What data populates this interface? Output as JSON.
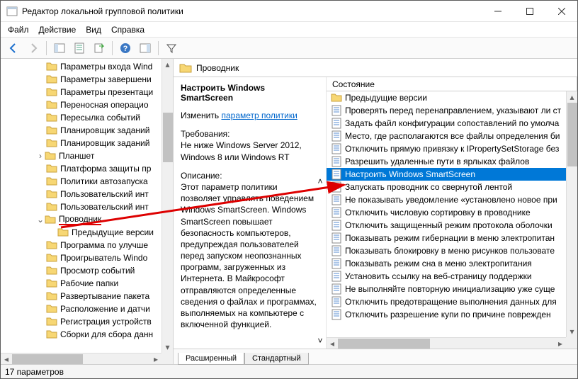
{
  "window": {
    "title": "Редактор локальной групповой политики"
  },
  "menu": {
    "file": "Файл",
    "action": "Действие",
    "view": "Вид",
    "help": "Справка"
  },
  "tree": {
    "items": [
      {
        "label": "Параметры входа Wind",
        "indent": 1
      },
      {
        "label": "Параметры завершени",
        "indent": 1
      },
      {
        "label": "Параметры презентаци",
        "indent": 1
      },
      {
        "label": "Переносная операцио",
        "indent": 1
      },
      {
        "label": "Пересылка событий",
        "indent": 1
      },
      {
        "label": "Планировщик заданий",
        "indent": 1
      },
      {
        "label": "Планировщик заданий",
        "indent": 1
      },
      {
        "label": "Планшет",
        "indent": 1,
        "expander": ">"
      },
      {
        "label": "Платформа защиты пр",
        "indent": 1
      },
      {
        "label": "Политики автозапуска",
        "indent": 1
      },
      {
        "label": "Пользовательский инт",
        "indent": 1
      },
      {
        "label": "Пользовательский инт",
        "indent": 1
      },
      {
        "label": "Проводник",
        "indent": 1,
        "expander": "v",
        "selected": true
      },
      {
        "label": "Предыдущие версии",
        "indent": 2
      },
      {
        "label": "Программа по улучше",
        "indent": 1
      },
      {
        "label": "Проигрыватель Windo",
        "indent": 1
      },
      {
        "label": "Просмотр событий",
        "indent": 1
      },
      {
        "label": "Рабочие папки",
        "indent": 1
      },
      {
        "label": "Развертывание пакета",
        "indent": 1
      },
      {
        "label": "Расположение и датчи",
        "indent": 1
      },
      {
        "label": "Регистрация устройств",
        "indent": 1
      },
      {
        "label": "Сборки для сбора данн",
        "indent": 1
      }
    ]
  },
  "header": {
    "folder_label": "Проводник"
  },
  "detail": {
    "heading": "Настроить Windows SmartScreen",
    "change_label": "Изменить ",
    "change_link": "параметр политики",
    "req_label": "Требования:",
    "req_text": "Не ниже Windows Server 2012, Windows 8 или Windows RT",
    "desc_label": "Описание:",
    "desc_text": "Этот параметр политики позволяет управлять поведением Windows SmartScreen. Windows SmartScreen повышает безопасность компьютеров, предупреждая пользователей перед запуском неопознанных программ, загруженных из Интернета. В Майкрософт отправляются определенные сведения о файлах и программах, выполняемых на компьютере с включенной функцией."
  },
  "list": {
    "column": "Состояние",
    "items": [
      {
        "icon": "folder",
        "label": "Предыдущие версии"
      },
      {
        "icon": "setting",
        "label": "Проверять перед перенаправлением, указывают ли ст"
      },
      {
        "icon": "setting",
        "label": "Задать файл конфигурации сопоставлений по умолча"
      },
      {
        "icon": "setting",
        "label": "Место, где располагаются все файлы определения би"
      },
      {
        "icon": "setting",
        "label": "Отключить прямую привязку к IPropertySetStorage без"
      },
      {
        "icon": "setting",
        "label": "Разрешить удаленные пути в ярлыках файлов"
      },
      {
        "icon": "setting",
        "label": "Настроить Windows SmartScreen",
        "selected": true
      },
      {
        "icon": "setting",
        "label": "Запускать проводник со свернутой лентой"
      },
      {
        "icon": "setting",
        "label": "Не показывать уведомление «установлено новое при"
      },
      {
        "icon": "setting",
        "label": "Отключить числовую сортировку в проводнике"
      },
      {
        "icon": "setting",
        "label": "Отключить защищенный режим протокола оболочки"
      },
      {
        "icon": "setting",
        "label": "Показывать режим гибернации в меню электропитан"
      },
      {
        "icon": "setting",
        "label": "Показывать блокировку в меню рисунков пользовате"
      },
      {
        "icon": "setting",
        "label": "Показывать режим сна в меню электропитания"
      },
      {
        "icon": "setting",
        "label": "Установить ссылку на веб-страницу поддержки"
      },
      {
        "icon": "setting",
        "label": "Не выполняйте повторную инициализацию уже суще"
      },
      {
        "icon": "setting",
        "label": "Отключить предотвращение выполнения данных для"
      },
      {
        "icon": "setting",
        "label": "Отключить разрешение купи по причине поврежден"
      }
    ]
  },
  "tabs": {
    "extended": "Расширенный",
    "standard": "Стандартный"
  },
  "status": {
    "text": "17 параметров"
  }
}
